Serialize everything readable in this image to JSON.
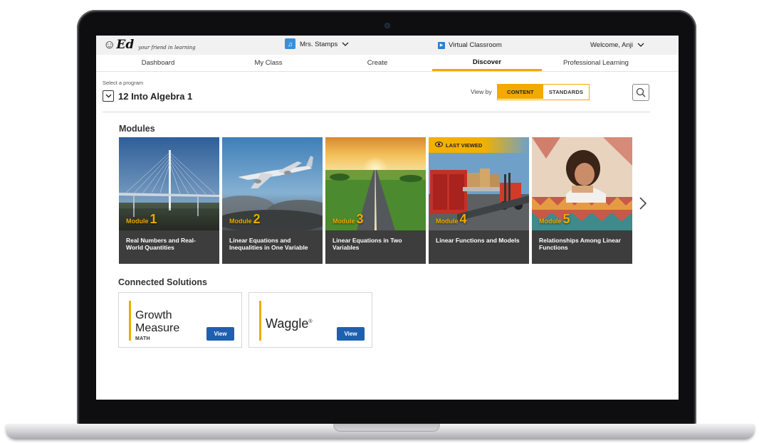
{
  "header": {
    "logo_text": "Ed",
    "logo_tagline": "your friend in learning",
    "teacher_name": "Mrs. Stamps",
    "virtual_classroom": "Virtual Classroom",
    "welcome": "Welcome, Anji"
  },
  "nav": {
    "items": [
      {
        "label": "Dashboard"
      },
      {
        "label": "My Class"
      },
      {
        "label": "Create"
      },
      {
        "label": "Discover"
      },
      {
        "label": "Professional Learning"
      }
    ],
    "active": "Discover"
  },
  "program": {
    "label": "Select a program",
    "selected": "12 Into Algebra 1"
  },
  "view_by": {
    "label": "View by",
    "options": [
      "CONTENT",
      "STANDARDS"
    ],
    "selected": "CONTENT"
  },
  "modules": {
    "title": "Modules",
    "items": [
      {
        "label": "Module",
        "number": "1",
        "title": "Real Numbers and Real-World Quantities"
      },
      {
        "label": "Module",
        "number": "2",
        "title": "Linear Equations and Inequalities in One Variable"
      },
      {
        "label": "Module",
        "number": "3",
        "title": "Linear Equations in Two Variables"
      },
      {
        "label": "Module",
        "number": "4",
        "title": "Linear Functions and Models",
        "badge": "LAST VIEWED"
      },
      {
        "label": "Module",
        "number": "5",
        "title": "Relationships Among Linear Functions"
      }
    ]
  },
  "connected": {
    "title": "Connected Solutions",
    "items": [
      {
        "line1": "Growth",
        "line2": "Measure",
        "sub": "MATH",
        "button": "View"
      },
      {
        "line1": "Waggle",
        "trademark": "®",
        "button": "View"
      }
    ]
  },
  "colors": {
    "accent": "#f2a900",
    "button_blue": "#1f5fb0",
    "caption_bg": "#3d3d3d"
  }
}
